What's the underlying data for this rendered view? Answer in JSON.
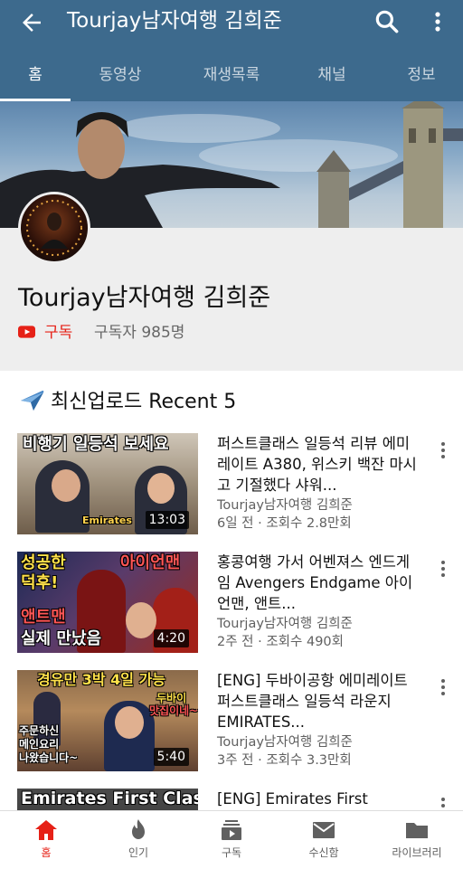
{
  "header": {
    "title": "Tourjay남자여행 김희준",
    "tabs": [
      {
        "label": "홈",
        "active": true
      },
      {
        "label": "동영상"
      },
      {
        "label": "재생목록"
      },
      {
        "label": "채널"
      },
      {
        "label": "정보"
      }
    ]
  },
  "channel": {
    "name": "Tourjay남자여행 김희준",
    "subscribe_label": "구독",
    "subscriber_text": "구독자 985명"
  },
  "section": {
    "title": "최신업로드 Recent 5"
  },
  "videos": [
    {
      "title": "퍼스트클래스 일등석 리뷰 에미레이트 A380, 위스키 백잔 마시고 기절했다 샤워...",
      "channel": "Tourjay남자여행 김희준",
      "meta": "6일 전 · 조회수 2.8만회",
      "duration": "13:03",
      "thumb_text": [
        "비행기 일등석 보세요",
        "Emirates"
      ]
    },
    {
      "title": "홍콩여행 가서 어벤져스 엔드게임 Avengers Endgame 아이언맨, 앤트...",
      "channel": "Tourjay남자여행 김희준",
      "meta": "2주 전 · 조회수 490회",
      "duration": "4:20",
      "thumb_text": [
        "성공한",
        "덕후!",
        "아이언맨",
        "앤트맨",
        "실제 만났음"
      ]
    },
    {
      "title": "[ENG] 두바이공항 에미레이트 퍼스트클래스 일등석 라운지 EMIRATES...",
      "channel": "Tourjay남자여행 김희준",
      "meta": "3주 전 · 조회수 3.3만회",
      "duration": "5:40",
      "thumb_text": [
        "경유만 3박 4일 가능",
        "두바이",
        "맛집이네~",
        "주문하신",
        "메인요리",
        "나왔습니다~"
      ]
    },
    {
      "title": "[ENG] Emirates First",
      "thumb_text": [
        "Emirates First Class"
      ]
    }
  ],
  "bottom_nav": [
    {
      "label": "홈",
      "icon": "home-icon",
      "active": true
    },
    {
      "label": "인기",
      "icon": "flame-icon"
    },
    {
      "label": "구독",
      "icon": "subscriptions-icon"
    },
    {
      "label": "수신함",
      "icon": "mail-icon"
    },
    {
      "label": "라이브러리",
      "icon": "folder-icon"
    }
  ],
  "colors": {
    "header_bg": "#3d6a8d",
    "accent_red": "#e62117"
  }
}
